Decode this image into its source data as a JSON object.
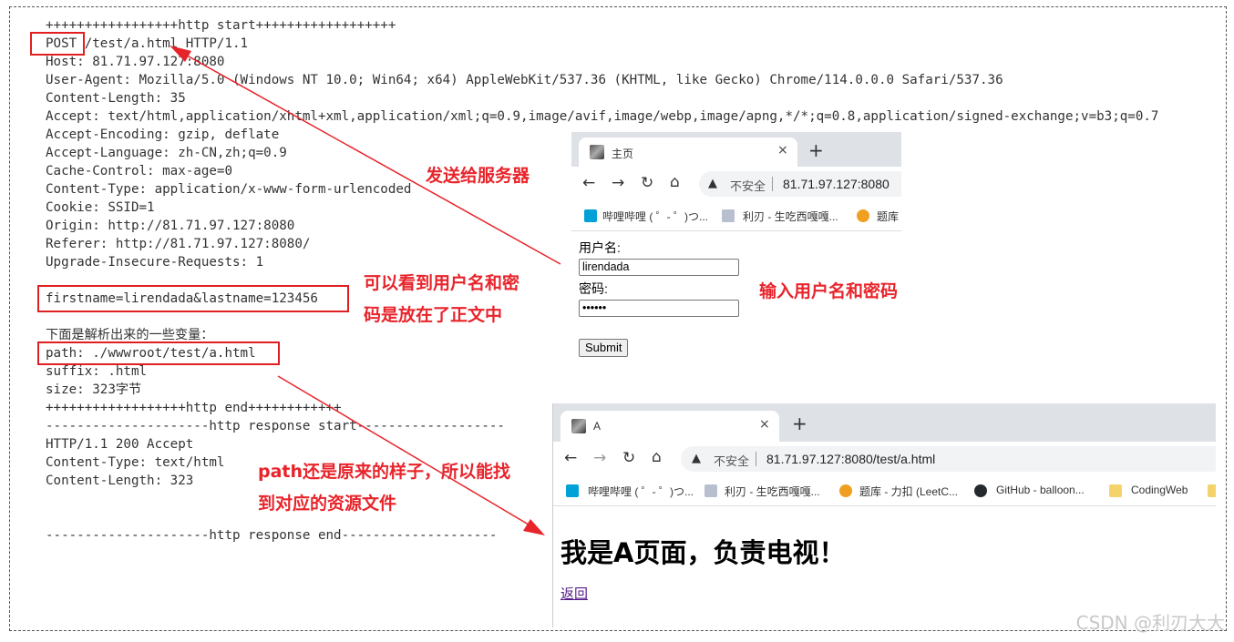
{
  "terminal": {
    "lines": [
      "+++++++++++++++++http start++++++++++++++++++",
      "POST /test/a.html HTTP/1.1",
      "Host: 81.71.97.127:8080",
      "User-Agent: Mozilla/5.0 (Windows NT 10.0; Win64; x64) AppleWebKit/537.36 (KHTML, like Gecko) Chrome/114.0.0.0 Safari/537.36",
      "Content-Length: 35",
      "Accept: text/html,application/xhtml+xml,application/xml;q=0.9,image/avif,image/webp,image/apng,*/*;q=0.8,application/signed-exchange;v=b3;q=0.7",
      "Accept-Encoding: gzip, deflate",
      "Accept-Language: zh-CN,zh;q=0.9",
      "Cache-Control: max-age=0",
      "Content-Type: application/x-www-form-urlencoded",
      "Cookie: SSID=1",
      "Origin: http://81.71.97.127:8080",
      "Referer: http://81.71.97.127:8080/",
      "Upgrade-Insecure-Requests: 1",
      "",
      "firstname=lirendada&lastname=123456",
      "",
      "下面是解析出来的一些变量：",
      "path: ./wwwroot/test/a.html",
      "suffix: .html",
      "size: 323字节",
      "++++++++++++++++++http end++++++++++++",
      "---------------------http response start-------------------",
      "HTTP/1.1 200 Accept",
      "Content-Type: text/html",
      "Content-Length: 323",
      "",
      "",
      "---------------------http response end--------------------"
    ]
  },
  "annotations": {
    "send_to_server": "发送给服务器",
    "body_note_line1": "可以看到用户名和密",
    "body_note_line2": "码是放在了正文中",
    "input_note": "输入用户名和密码",
    "path_note_line1": "path还是原来的样子，所以能找",
    "path_note_line2": "到对应的资源文件"
  },
  "browser1": {
    "tab_title": "主页",
    "close": "×",
    "new_tab": "+",
    "insecure": "不安全",
    "url": "81.71.97.127:8080",
    "bookmarks": [
      "哔哩哔哩 ( ゜- ゜)つ...",
      "利刃 - 生吃西嘎嘎...",
      "题库"
    ],
    "form": {
      "username_label": "用户名:",
      "username_value": "lirendada",
      "password_label": "密码:",
      "password_value": "••••••",
      "submit": "Submit"
    }
  },
  "browser2": {
    "tab_title": "A",
    "close": "×",
    "new_tab": "+",
    "insecure": "不安全",
    "url": "81.71.97.127:8080/test/a.html",
    "bookmarks": [
      "哔哩哔哩 ( ゜- ゜)つ...",
      "利刃 - 生吃西嘎嘎...",
      "题库 - 力扣 (LeetC...",
      "GitHub - balloon...",
      "CodingWeb"
    ],
    "heading": "我是A页面，负责电视！",
    "back_link": "返回"
  },
  "watermark": "CSDN @利刃大大",
  "colors": {
    "annotation_red": "#e8242b",
    "tab_strip": "#dee1e6",
    "url_bar": "#f1f3f4",
    "link": "#551a8b"
  }
}
